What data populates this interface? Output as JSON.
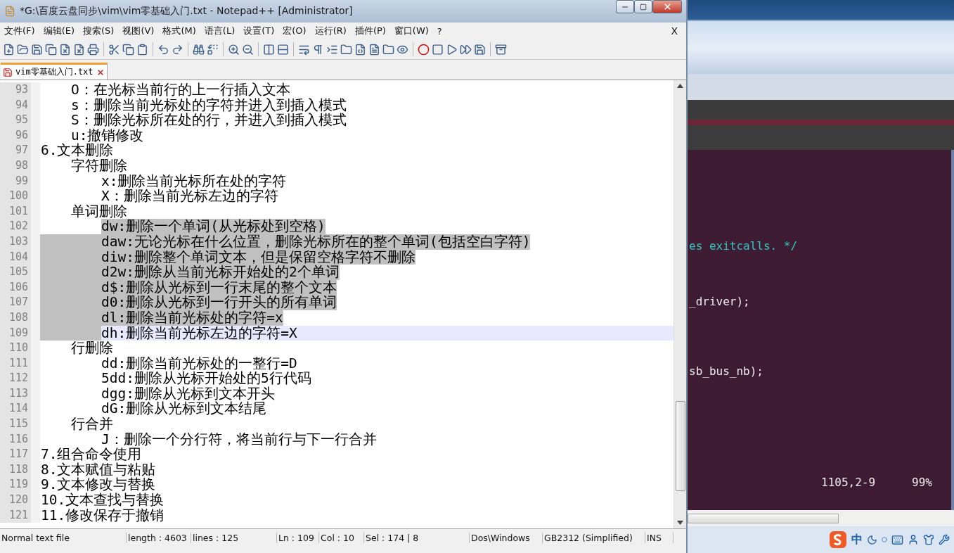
{
  "window": {
    "title": "*G:\\百度云盘同步\\vim\\vim零基础入门.txt - Notepad++ [Administrator]"
  },
  "menu": [
    {
      "label": "文件(F)"
    },
    {
      "label": "编辑(E)"
    },
    {
      "label": "搜索(S)"
    },
    {
      "label": "视图(V)"
    },
    {
      "label": "格式(M)"
    },
    {
      "label": "语言(L)"
    },
    {
      "label": "设置(T)"
    },
    {
      "label": "宏(O)"
    },
    {
      "label": "运行(R)"
    },
    {
      "label": "插件(P)"
    },
    {
      "label": "窗口(W)"
    },
    {
      "label": "?"
    }
  ],
  "menu_close": "X",
  "tabs": [
    {
      "label": "vim零基础入门.txt",
      "selected": true
    }
  ],
  "outline": [
    {
      "children": [
        {
          "number": "93",
          "text": "O：在光标当前行的上一行插入文本",
          "selected": false,
          "current": false
        },
        {
          "number": "94",
          "text": "s：删除当前光标处的字符并进入到插入模式",
          "selected": false,
          "current": false
        },
        {
          "number": "95",
          "text": "S：删除光标所在处的行，并进入到插入模式",
          "selected": false,
          "current": false
        },
        {
          "number": "96",
          "text": "u:撤销修改",
          "selected": false,
          "current": false
        }
      ]
    },
    {
      "number": "97",
      "text": "6.文本删除",
      "selected": false,
      "current": false,
      "children": [
        {
          "number": "98",
          "text": "字符删除",
          "selected": false,
          "current": false,
          "children": [
            {
              "number": "99",
              "text": "x:删除当前光标所在处的字符",
              "selected": false,
              "current": false
            },
            {
              "number": "100",
              "text": "X：删除当前光标左边的字符",
              "selected": false,
              "current": false
            }
          ]
        },
        {
          "number": "101",
          "text": "单词删除",
          "selected": false,
          "current": false,
          "children": [
            {
              "number": "102",
              "text": "dw:删除一个单词(从光标处到空格)",
              "selected": true,
              "current": false
            },
            {
              "number": "103",
              "text": "daw:无论光标在什么位置，删除光标所在的整个单词(包括空白字符)",
              "selected": true,
              "current": false
            },
            {
              "number": "104",
              "text": "diw:删除整个单词文本，但是保留空格字符不删除",
              "selected": true,
              "current": false
            },
            {
              "number": "105",
              "text": "d2w:删除从当前光标开始处的2个单词",
              "selected": true,
              "current": false
            },
            {
              "number": "106",
              "text": "d$:删除从光标到一行末尾的整个文本",
              "selected": true,
              "current": false
            },
            {
              "number": "107",
              "text": "d0:删除从光标到一行开头的所有单词",
              "selected": true,
              "current": false
            },
            {
              "number": "108",
              "text": "dl:删除当前光标处的字符=x",
              "selected": true,
              "current": false
            },
            {
              "number": "109",
              "text": "dh:删除当前光标左边的字符=X",
              "selected": false,
              "current": true
            }
          ]
        },
        {
          "number": "110",
          "text": "行删除",
          "selected": false,
          "current": false,
          "children": [
            {
              "number": "111",
              "text": "dd:删除当前光标处的一整行=D",
              "selected": false,
              "current": false
            },
            {
              "number": "112",
              "text": "5dd:删除从光标开始处的5行代码",
              "selected": false,
              "current": false
            },
            {
              "number": "113",
              "text": "dgg:删除从光标到文本开头",
              "selected": false,
              "current": false
            },
            {
              "number": "114",
              "text": "dG:删除从光标到文本结尾",
              "selected": false,
              "current": false
            }
          ]
        },
        {
          "number": "115",
          "text": "行合并",
          "selected": false,
          "current": false,
          "children": [
            {
              "number": "116",
              "text": "J：删除一个分行符，将当前行与下一行合并",
              "selected": false,
              "current": false
            }
          ]
        }
      ]
    },
    {
      "number": "117",
      "text": "7.组合命令使用",
      "selected": false,
      "current": false
    },
    {
      "number": "118",
      "text": "8.文本赋值与粘贴",
      "selected": false,
      "current": false
    },
    {
      "number": "119",
      "text": "9.文本修改与替换",
      "selected": false,
      "current": false
    },
    {
      "number": "120",
      "text": "10.文本查找与替换",
      "selected": false,
      "current": false
    },
    {
      "number": "121",
      "text": "11.修改保存于撤销",
      "selected": false,
      "current": false
    }
  ],
  "status_bar": [
    "Normal text file",
    "length : 4603",
    "lines : 125",
    "Ln : 109",
    "Col : 10",
    "Sel : 174 | 8",
    "Dos\\Windows",
    "GB2312 (Simplified)",
    "INS"
  ],
  "terminal": {
    "lines": [
      {
        "text": "es exitcalls. */",
        "kind": "comment"
      },
      {
        "text": "_driver);",
        "kind": "code"
      },
      {
        "text": "sb_bus_nb);",
        "kind": "code"
      }
    ],
    "position": "1105,2-9",
    "percent": "99%"
  },
  "ime": {
    "mode": "中"
  }
}
